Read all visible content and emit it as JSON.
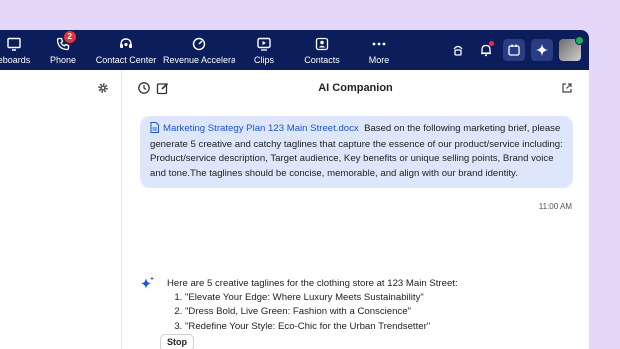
{
  "nav": {
    "items": [
      {
        "label": "eboards",
        "icon": "whiteboard-icon"
      },
      {
        "label": "Phone",
        "icon": "phone-icon",
        "badge": "2"
      },
      {
        "label": "Contact Center",
        "icon": "contact-center-icon"
      },
      {
        "label": "Revenue Accelera",
        "icon": "revenue-accelerator-icon"
      },
      {
        "label": "Clips",
        "icon": "clips-icon"
      },
      {
        "label": "Contacts",
        "icon": "contacts-icon"
      },
      {
        "label": "More",
        "icon": "more-icon"
      }
    ]
  },
  "chat": {
    "title": "AI Companion",
    "user_message": {
      "attachment": "Marketing Strategy Plan 123 Main Street.docx",
      "text": "Based on the following marketing brief, please generate 5 creative and catchy taglines that capture the essence of our product/service including: Product/service description, Target audience, Key benefits or unique selling points, Brand voice and tone.The taglines should be concise, memorable, and align with our brand identity.",
      "time": "11:00 AM"
    },
    "ai_message": {
      "intro": "Here are 5 creative taglines for the clothing store at 123 Main Street:",
      "taglines": [
        "\"Elevate Your Edge: Where Luxury Meets Sustainability\"",
        "\"Dress Bold, Live Green: Fashion with a Conscience\"",
        "\"Redefine Your Style: Eco-Chic for the Urban Trendsetter\""
      ]
    },
    "stop_label": "Stop"
  },
  "colors": {
    "topbar": "#0b1e5b",
    "accent": "#1a55d6",
    "bubble": "#dde6fb",
    "background": "#e4d7f7"
  }
}
